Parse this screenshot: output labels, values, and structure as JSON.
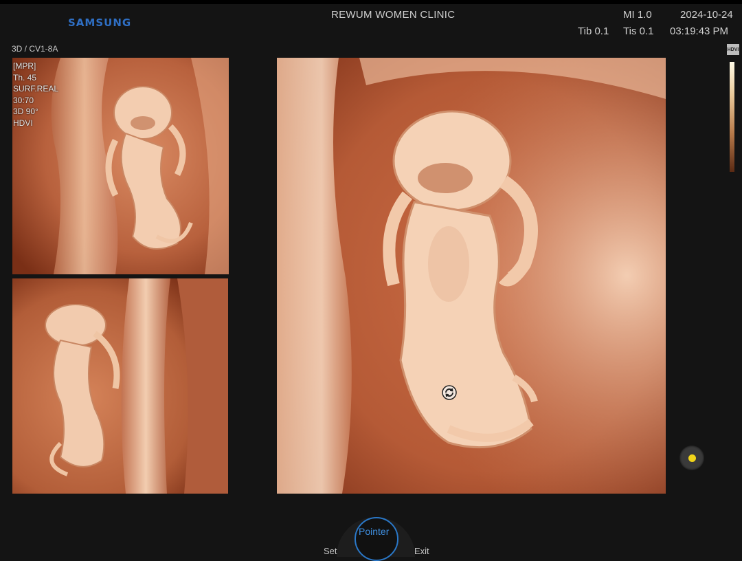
{
  "header": {
    "brand": "SAMSUNG",
    "clinic": "REWUM WOMEN CLINIC",
    "mi": "MI 1.0",
    "tib": "Tib 0.1",
    "tis": "Tis 0.1",
    "date": "2024-10-24",
    "time": "03:19:43 PM"
  },
  "probe": "3D / CV1-8A",
  "params": [
    "[MPR]",
    "Th. 45",
    "SURF.REAL",
    "30:70",
    "3D 90°",
    "HDVI"
  ],
  "right_panel": {
    "badge": "HDVI"
  },
  "controls": {
    "pointer": "Pointer",
    "set": "Set",
    "exit": "Exit"
  },
  "colors": {
    "background": "#141414",
    "brand": "#2f6fc4",
    "tissue_dark": "#8a3a1e",
    "tissue_mid": "#c9714b",
    "tissue_light": "#f4cfb0",
    "cursor": "#f1d41a",
    "dial_accent": "#2a78c8"
  },
  "icons": [
    "rotate-icon",
    "cursor-dot-icon"
  ]
}
